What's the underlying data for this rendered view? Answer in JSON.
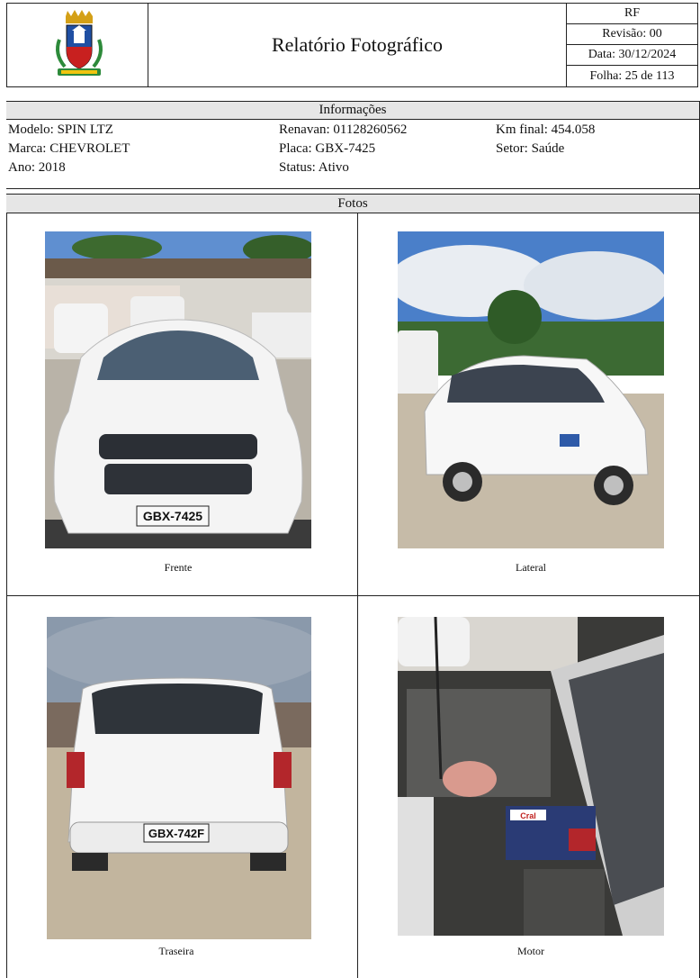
{
  "header": {
    "title": "Relatório Fotográfico",
    "code": "RF",
    "revision": "Revisão: 00",
    "date": "Data: 30/12/2024",
    "sheet": "Folha: 25 de 113"
  },
  "info": {
    "section_title": "Informações",
    "model": "Modelo: SPIN LTZ",
    "brand": "Marca: CHEVROLET",
    "year": "Ano: 2018",
    "renavan": "Renavan: 01128260562",
    "plate": "Placa: GBX-7425",
    "status": "Status: Ativo",
    "km": "Km final: 454.058",
    "sector": "Setor: Saúde"
  },
  "photos": {
    "section_title": "Fotos",
    "items": [
      {
        "caption": "Frente",
        "plate_text": "GBX-7425"
      },
      {
        "caption": "Lateral"
      },
      {
        "caption": "Traseira",
        "plate_text": "GBX-742F"
      },
      {
        "caption": "Motor",
        "battery_text": "Cral"
      }
    ]
  },
  "colors": {
    "header_bar": "#e6e6e6",
    "border": "#222222",
    "car_white": "#f2f2f2",
    "sky": "#4a7fc9"
  }
}
